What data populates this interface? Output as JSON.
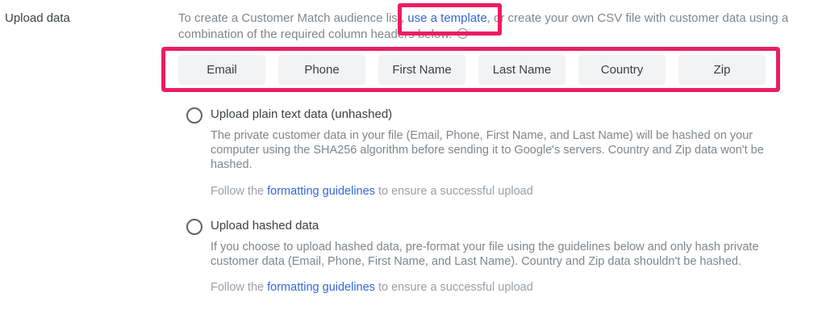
{
  "section": {
    "label": "Upload data"
  },
  "intro": {
    "text_before": "To create a Customer Match audience list, ",
    "template_link": "use a template",
    "text_after": ", or create your own CSV file with customer data using a combination of the required column headers below.",
    "info_icon": "info-icon"
  },
  "columns": [
    "Email",
    "Phone",
    "First Name",
    "Last Name",
    "Country",
    "Zip"
  ],
  "options": [
    {
      "title": "Upload plain text data (unhashed)",
      "description": "The private customer data in your file (Email, Phone, First Name, and Last Name) will be hashed on your computer using the SHA256 algorithm before sending it to Google's servers. Country and Zip data won't be hashed.",
      "follow_before": "Follow the ",
      "follow_link": "formatting guidelines",
      "follow_after": " to ensure a successful upload"
    },
    {
      "title": "Upload hashed data",
      "description": "If you choose to upload hashed data, pre-format your file using the guidelines below and only hash private customer data (Email, Phone, First Name, and Last Name). Country and Zip data shouldn't be hashed.",
      "follow_before": "Follow the ",
      "follow_link": "formatting guidelines",
      "follow_after": " to ensure a successful upload"
    }
  ],
  "colors": {
    "highlight": "#ea1d63",
    "link": "#3367d6",
    "chip_bg": "#f1f3f4"
  }
}
